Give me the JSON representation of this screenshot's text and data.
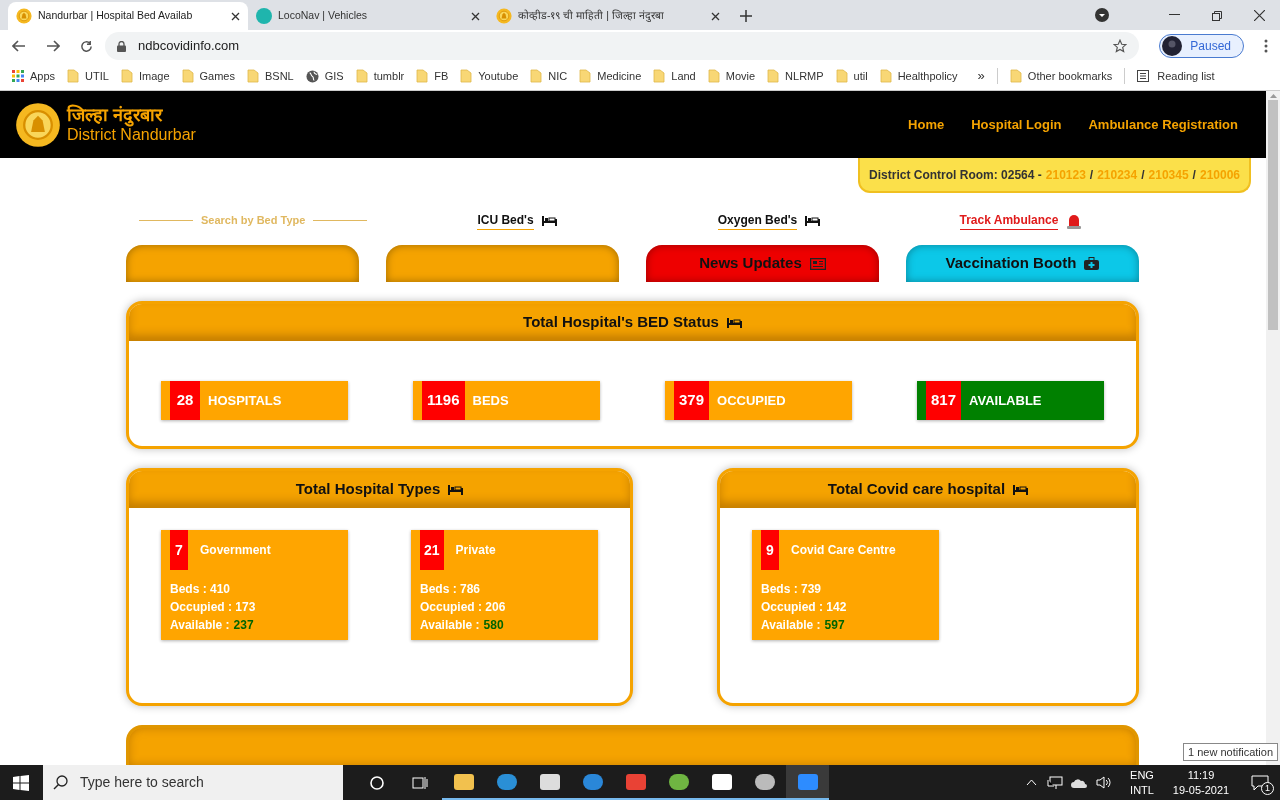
{
  "browser": {
    "tabs": [
      {
        "title": "Nandurbar | Hospital Bed Availab",
        "selected": true
      },
      {
        "title": "LocoNav | Vehicles",
        "selected": false
      },
      {
        "title": "कोव्हीड-१९ ची माहिती | जिल्हा नंदुरबा",
        "selected": false
      }
    ],
    "url": "ndbcovidinfo.com",
    "profile": "Paused",
    "bookmarks": [
      {
        "label": "Apps",
        "kind": "apps"
      },
      {
        "label": "UTIL",
        "kind": "folder"
      },
      {
        "label": "Image",
        "kind": "folder"
      },
      {
        "label": "Games",
        "kind": "folder"
      },
      {
        "label": "BSNL",
        "kind": "folder"
      },
      {
        "label": "GIS",
        "kind": "globe"
      },
      {
        "label": "tumblr",
        "kind": "folder"
      },
      {
        "label": "FB",
        "kind": "folder"
      },
      {
        "label": "Youtube",
        "kind": "folder"
      },
      {
        "label": "NIC",
        "kind": "folder"
      },
      {
        "label": "Medicine",
        "kind": "folder"
      },
      {
        "label": "Land",
        "kind": "folder"
      },
      {
        "label": "Movie",
        "kind": "folder"
      },
      {
        "label": "NLRMP",
        "kind": "folder"
      },
      {
        "label": "util",
        "kind": "folder"
      },
      {
        "label": "Healthpolicy",
        "kind": "folder"
      }
    ],
    "overflow": "»",
    "other_bookmarks": "Other bookmarks",
    "reading_list": "Reading list"
  },
  "site": {
    "title_local": "जिल्हा नंदुरबार",
    "title": "District Nandurbar",
    "nav": [
      "Home",
      "Hospital Login",
      "Ambulance Registration"
    ],
    "control_room": {
      "label": "District Control Room: 02564 -",
      "numbers": [
        "210123",
        "210234",
        "210345",
        "210006"
      ],
      "separators": [
        "/",
        "/",
        "/"
      ]
    },
    "search_label": "Search by Bed Type",
    "filters": [
      {
        "label": "ICU Bed's",
        "kind": "bed"
      },
      {
        "label": "Oxygen Bed's",
        "kind": "bed"
      },
      {
        "label": "Track Ambulance",
        "kind": "siren"
      }
    ],
    "buttons": [
      {
        "color": "#f5a300"
      },
      {
        "color": "#f5a300"
      },
      {
        "label": "News Updates",
        "color": "#ee0000",
        "kind": "news"
      },
      {
        "label": "Vaccination Booth",
        "color": "#0cc8e8",
        "kind": "medkit"
      }
    ],
    "bed_status": {
      "title": "Total Hospital's BED Status",
      "stats": [
        {
          "value": "28",
          "label": "HOSPITALS",
          "color": "#ffa500"
        },
        {
          "value": "1196",
          "label": "BEDS",
          "color": "#ffa500"
        },
        {
          "value": "379",
          "label": "OCCUPIED",
          "color": "#ffa500"
        },
        {
          "value": "817",
          "label": "AVAILABLE",
          "color": "#008000"
        }
      ]
    },
    "type_cards": [
      {
        "title": "Total Hospital Types",
        "items": [
          {
            "value": "7",
            "label": "Government",
            "beds": "Beds : 410",
            "occupied": "Occupied : 173",
            "available_label": "Available :",
            "available": "237"
          },
          {
            "value": "21",
            "label": "Private",
            "beds": "Beds : 786",
            "occupied": "Occupied : 206",
            "available_label": "Available :",
            "available": "580"
          }
        ]
      },
      {
        "title": "Total Covid care hospital",
        "items": [
          {
            "value": "9",
            "label": "Covid Care Centre",
            "beds": "Beds : 739",
            "occupied": "Occupied : 142",
            "available_label": "Available :",
            "available": "597"
          }
        ]
      }
    ]
  },
  "taskbar": {
    "search_placeholder": "Type here to search",
    "lang": [
      "ENG",
      "INTL"
    ],
    "time": "11:19",
    "date": "19-05-2021",
    "notification_tooltip": "1 new notification",
    "notification_count": "1"
  }
}
